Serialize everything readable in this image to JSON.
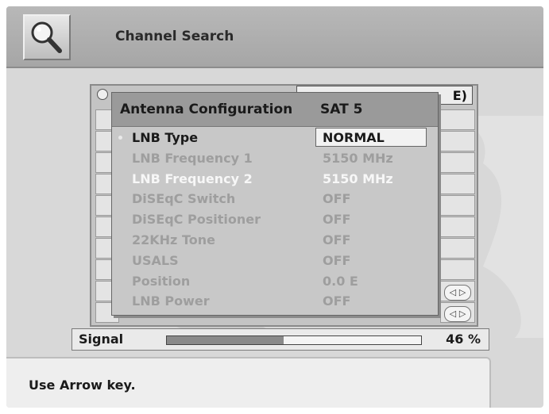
{
  "header": {
    "title": "Channel Search",
    "icon": "magnifier-icon"
  },
  "background_list": {
    "header_text": "E)"
  },
  "dialog": {
    "title": "Antenna Configuration",
    "satellite": "SAT 5",
    "options": [
      {
        "label": "LNB Type",
        "value": "NORMAL",
        "state": "active"
      },
      {
        "label": "LNB Frequency 1",
        "value": "5150 MHz",
        "state": "disabled"
      },
      {
        "label": "LNB Frequency 2",
        "value": "5150 MHz",
        "state": "highlight"
      },
      {
        "label": "DiSEqC Switch",
        "value": "OFF",
        "state": "disabled"
      },
      {
        "label": "DiSEqC Positioner",
        "value": "OFF",
        "state": "disabled"
      },
      {
        "label": "22KHz Tone",
        "value": "OFF",
        "state": "disabled"
      },
      {
        "label": "USALS",
        "value": "OFF",
        "state": "disabled"
      },
      {
        "label": "Position",
        "value": "0.0  E",
        "state": "disabled"
      },
      {
        "label": "LNB Power",
        "value": "OFF",
        "state": "disabled"
      }
    ]
  },
  "signal": {
    "label": "Signal",
    "value_text": "46 %",
    "level": 0.46
  },
  "help": {
    "text": "Use Arrow key."
  },
  "colors": {
    "background": "#d8d8d8",
    "title_bar": "#a8a8a8",
    "dialog": "#c8c8c8",
    "dialog_header": "#9a9a9a"
  }
}
